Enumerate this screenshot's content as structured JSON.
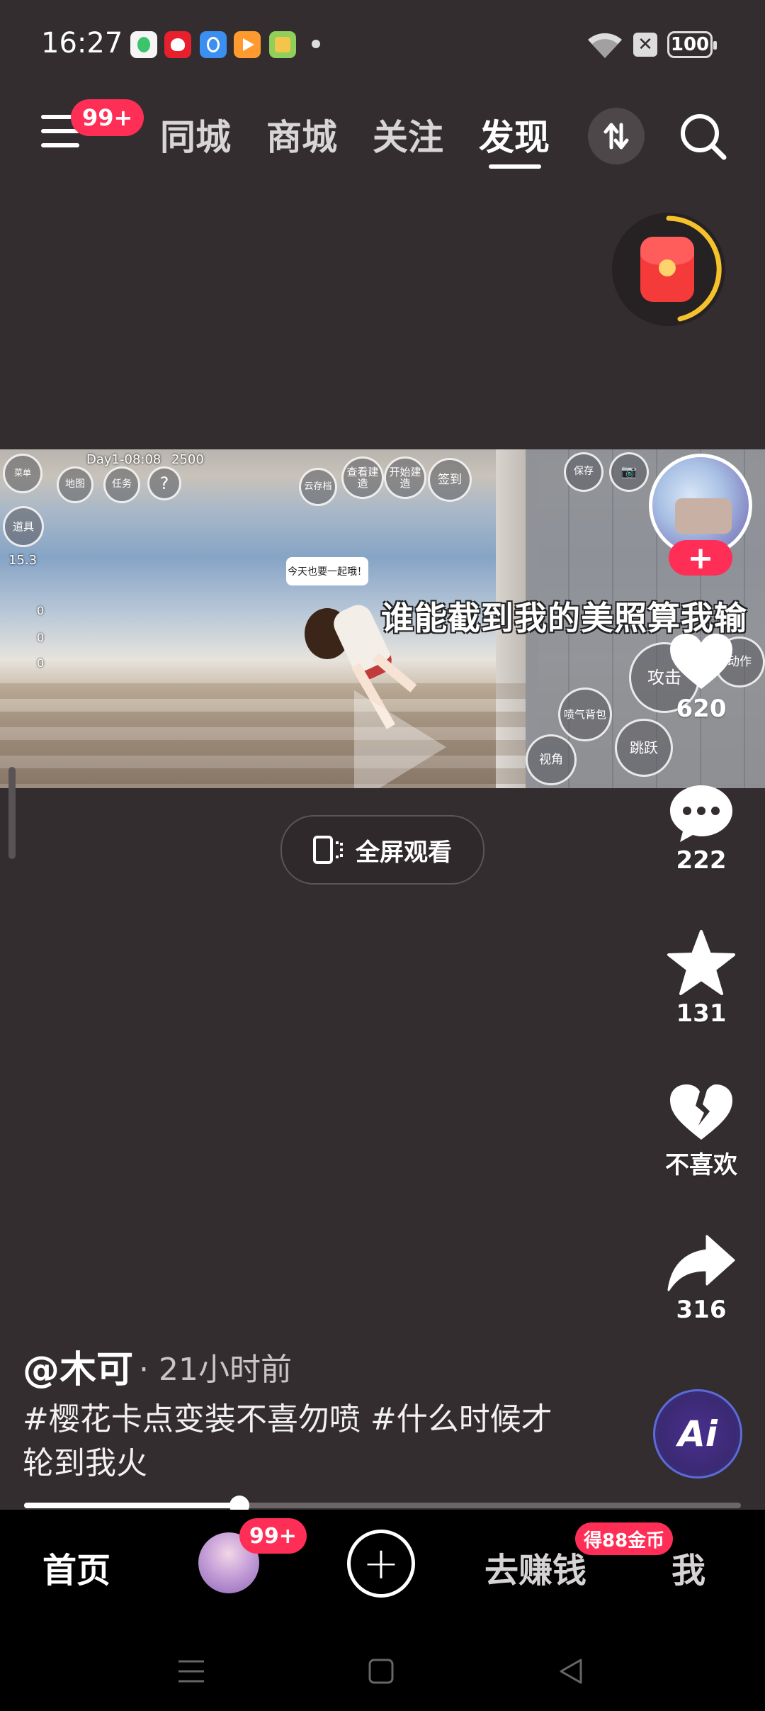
{
  "status_bar": {
    "time": "16:27",
    "battery": "100",
    "icons": [
      "wifi-icon",
      "sim-off-icon",
      "battery-icon"
    ]
  },
  "top_nav": {
    "menu_badge": "99+",
    "tabs": [
      {
        "label": "同城",
        "active": false
      },
      {
        "label": "商城",
        "active": false
      },
      {
        "label": "关注",
        "active": false
      },
      {
        "label": "发现",
        "active": true
      }
    ]
  },
  "video": {
    "overlay_caption": "谁能截到我的美照算我输",
    "hud_day": "Day1-08:08",
    "hud_money": "2500",
    "hud_value": "15.3",
    "hud_counters": [
      "0",
      "0",
      "0"
    ],
    "buttons": {
      "menu": "菜单",
      "map": "地图",
      "task": "任务",
      "props": "道具",
      "cloud": "云存档",
      "view_build": "查看建造",
      "start_build": "开始建造",
      "sign_in": "签到",
      "save": "保存",
      "attack": "攻击",
      "action": "动作",
      "jump": "跳跃",
      "view_angle": "视角",
      "jet_pack": "喷气背包"
    },
    "speech_text": "今天也要一起哦！",
    "fullscreen_label": "全屏观看"
  },
  "actions": {
    "likes": "620",
    "comments": "222",
    "favorites": "131",
    "dislike_label": "不喜欢",
    "shares": "316"
  },
  "post": {
    "author": "@木可",
    "time": "· 21小时前",
    "description": "#樱花卡点变装不喜勿喷 #什么时候才轮到我火",
    "ai_label": "Ai"
  },
  "progress": 0.3,
  "bottom_nav": {
    "home": "首页",
    "friends_badge": "99+",
    "earn": "去赚钱",
    "coin_badge": "得88金币",
    "me": "我"
  },
  "colors": {
    "background": "#332d2f",
    "accent": "#ff2e56",
    "nav_bar": "#000000"
  }
}
